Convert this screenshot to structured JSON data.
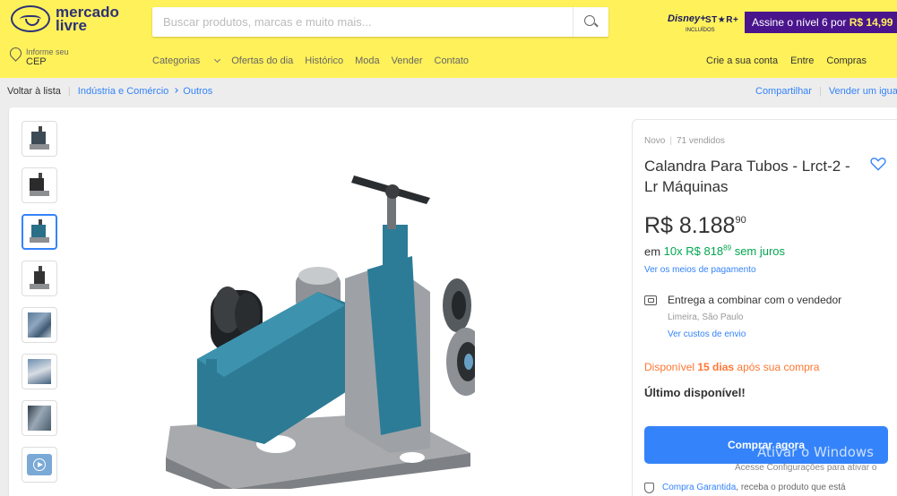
{
  "header": {
    "logo_line1": "mercado",
    "logo_line2": "livre",
    "search_placeholder": "Buscar produtos, marcas e muito mais...",
    "disney_brand": "Disney+",
    "star_brand": "ST★R+",
    "disney_included": "INCLUÍDOS",
    "promo_text": "Assine o nível 6 por ",
    "promo_price": "R$ 14,99",
    "cep_small": "Informe seu",
    "cep_big": "CEP",
    "nav_categories": "Categorias",
    "nav": [
      "Ofertas do dia",
      "Histórico",
      "Moda",
      "Vender",
      "Contato"
    ],
    "account": [
      "Crie a sua conta",
      "Entre",
      "Compras"
    ]
  },
  "breadcrumb": {
    "back": "Voltar à lista",
    "cat1": "Indústria e Comércio",
    "cat2": "Outros",
    "share": "Compartilhar",
    "sell": "Vender um igual"
  },
  "product": {
    "condition": "Novo",
    "sold": "71 vendidos",
    "title": "Calandra Para Tubos - Lrct-2 - Lr Máquinas",
    "price_int": "R$ 8.188",
    "price_cents": "90",
    "inst_pre": "em ",
    "inst_green": "10x R$ 818",
    "inst_cents": "89",
    "inst_post": " sem juros",
    "payment_link": "Ver os meios de pagamento",
    "delivery": "Entrega a combinar com o vendedor",
    "location": "Limeira, São Paulo",
    "shipping_link": "Ver custos de envio",
    "avail_pre": "Disponível ",
    "avail_bold": "15 dias",
    "avail_post": " após sua compra",
    "last_unit": "Último disponível!",
    "buy_button": "Comprar agora",
    "guarantee_link": "Compra Garantida",
    "guarantee_text": ", receba o produto que está"
  },
  "watermark": {
    "line1": "Ativar o Windows",
    "line2": "Acesse Configurações para ativar o"
  },
  "colors": {
    "header_yellow": "#fff159",
    "accent_blue": "#3483fa",
    "green": "#00a650",
    "orange": "#ff7733",
    "promo_purple": "#4a148c"
  }
}
